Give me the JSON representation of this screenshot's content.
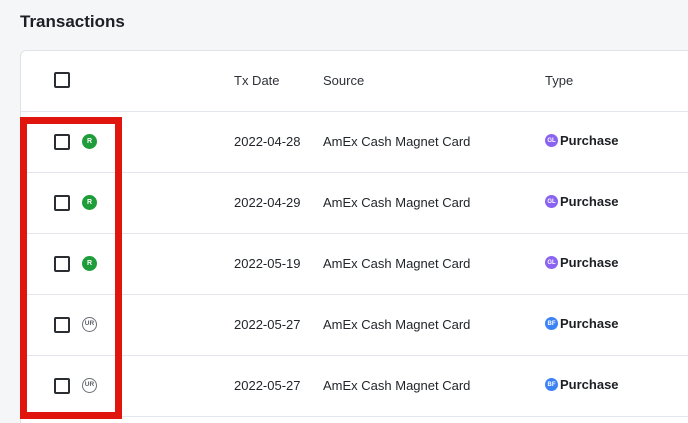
{
  "page": {
    "title": "Transactions"
  },
  "table": {
    "columns": {
      "tx_date": "Tx Date",
      "source": "Source",
      "type": "Type"
    },
    "rows": [
      {
        "status": "R",
        "status_style": "filled",
        "date": "2022-04-28",
        "source": "AmEx Cash Magnet Card",
        "type_badge": "GL",
        "type_badge_color": "#8a63f0",
        "type": "Purchase"
      },
      {
        "status": "R",
        "status_style": "filled",
        "date": "2022-04-29",
        "source": "AmEx Cash Magnet Card",
        "type_badge": "GL",
        "type_badge_color": "#8a63f0",
        "type": "Purchase"
      },
      {
        "status": "R",
        "status_style": "filled",
        "date": "2022-05-19",
        "source": "AmEx Cash Magnet Card",
        "type_badge": "GL",
        "type_badge_color": "#8a63f0",
        "type": "Purchase"
      },
      {
        "status": "UR",
        "status_style": "outline",
        "date": "2022-05-27",
        "source": "AmEx Cash Magnet Card",
        "type_badge": "BF",
        "type_badge_color": "#3b82f6",
        "type": "Purchase"
      },
      {
        "status": "UR",
        "status_style": "outline",
        "date": "2022-05-27",
        "source": "AmEx Cash Magnet Card",
        "type_badge": "BF",
        "type_badge_color": "#3b82f6",
        "type": "Purchase"
      }
    ]
  },
  "colors": {
    "highlight": "#e0150d",
    "reconciled": "#1f9d3a"
  }
}
